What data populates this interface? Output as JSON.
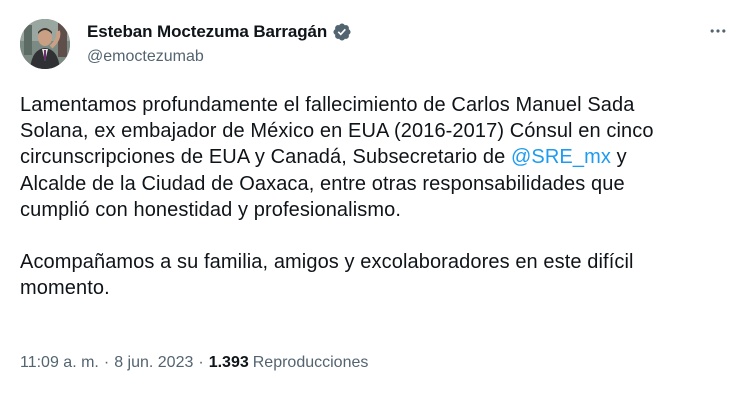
{
  "author": {
    "display_name": "Esteban Moctezuma Barragán",
    "handle": "@emoctezumab",
    "verified": true
  },
  "tweet": {
    "line1": "Lamentamos profundamente el fallecimiento de Carlos Manuel Sada",
    "line2": "Solana, ex embajador de México en EUA (2016-2017)  Cónsul en cinco",
    "line3": "circunscripciones de EUA y Canadá, Subsecretario de ",
    "mention": "@SRE_mx",
    "line3_end": " y",
    "line4": "Alcalde de la Ciudad de Oaxaca, entre otras responsabilidades que",
    "line5": "cumplió con honestidad y profesionalismo.",
    "line6": "Acompañamos a su familia, amigos y excolaboradores en este difícil",
    "line7": "momento."
  },
  "meta": {
    "time": "11:09 a. m.",
    "separator": "·",
    "date": "8 jun. 2023",
    "views_count": "1.393",
    "views_label": "Reproducciones"
  },
  "colors": {
    "text": "#0f1419",
    "secondary": "#536471",
    "link": "#1d9bf0",
    "verified_badge": "#536471"
  },
  "icons": {
    "verified": "verified-badge-icon",
    "more": "more-options-icon"
  }
}
